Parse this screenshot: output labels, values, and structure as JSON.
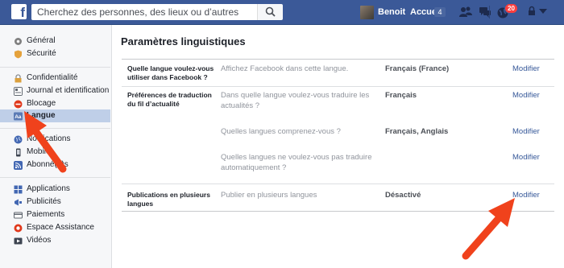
{
  "topbar": {
    "logo": "f",
    "search_placeholder": "Cherchez des personnes, des lieux ou d’autres choses",
    "user_name": "Benoit",
    "home_label": "Accueil",
    "home_count": "4",
    "notifications_count": "20",
    "icons": [
      "search-icon",
      "friends-icon",
      "messages-icon",
      "globe-notifications-icon",
      "lock-icon",
      "caret-down-icon"
    ]
  },
  "sidebar": {
    "items": [
      {
        "label": "Général",
        "icon": "gear-icon"
      },
      {
        "label": "Sécurité",
        "icon": "shield-icon"
      },
      {
        "label": "Confidentialité",
        "icon": "lock-icon"
      },
      {
        "label": "Journal et identification",
        "icon": "timeline-icon"
      },
      {
        "label": "Blocage",
        "icon": "block-icon"
      },
      {
        "label": "Langue",
        "icon": "language-icon"
      },
      {
        "label": "Notifications",
        "icon": "globe-icon"
      },
      {
        "label": "Mobile",
        "icon": "mobile-icon"
      },
      {
        "label": "Abonné(e)s",
        "icon": "rss-icon"
      },
      {
        "label": "Applications",
        "icon": "apps-icon"
      },
      {
        "label": "Publicités",
        "icon": "ads-icon"
      },
      {
        "label": "Paiements",
        "icon": "payments-icon"
      },
      {
        "label": "Espace Assistance",
        "icon": "support-icon"
      },
      {
        "label": "Vidéos",
        "icon": "video-icon"
      }
    ]
  },
  "main": {
    "title": "Paramètres linguistiques",
    "rows": [
      {
        "label": "Quelle langue voulez-vous utiliser dans Facebook ?",
        "desc": "Affichez Facebook dans cette langue.",
        "value": "Français (France)",
        "action": "Modifier"
      },
      {
        "label": "Préférences de traduction du fil d’actualité",
        "desc": "Dans quelle langue voulez-vous traduire les actualités ?",
        "value": "Français",
        "action": "Modifier"
      },
      {
        "label": "",
        "desc": "Quelles langues comprenez-vous ?",
        "value": "Français, Anglais",
        "action": "Modifier"
      },
      {
        "label": "",
        "desc": "Quelles langues ne voulez-vous pas traduire automatiquement ?",
        "value": "",
        "action": "Modifier"
      },
      {
        "label": "Publications en plusieurs langues",
        "desc": "Publier en plusieurs langues",
        "value": "Désactivé",
        "action": "Modifier"
      }
    ]
  },
  "colors": {
    "brand": "#3b5998",
    "link": "#365899",
    "arrow": "#f0421c",
    "active_nav": "#bfcfe8"
  }
}
